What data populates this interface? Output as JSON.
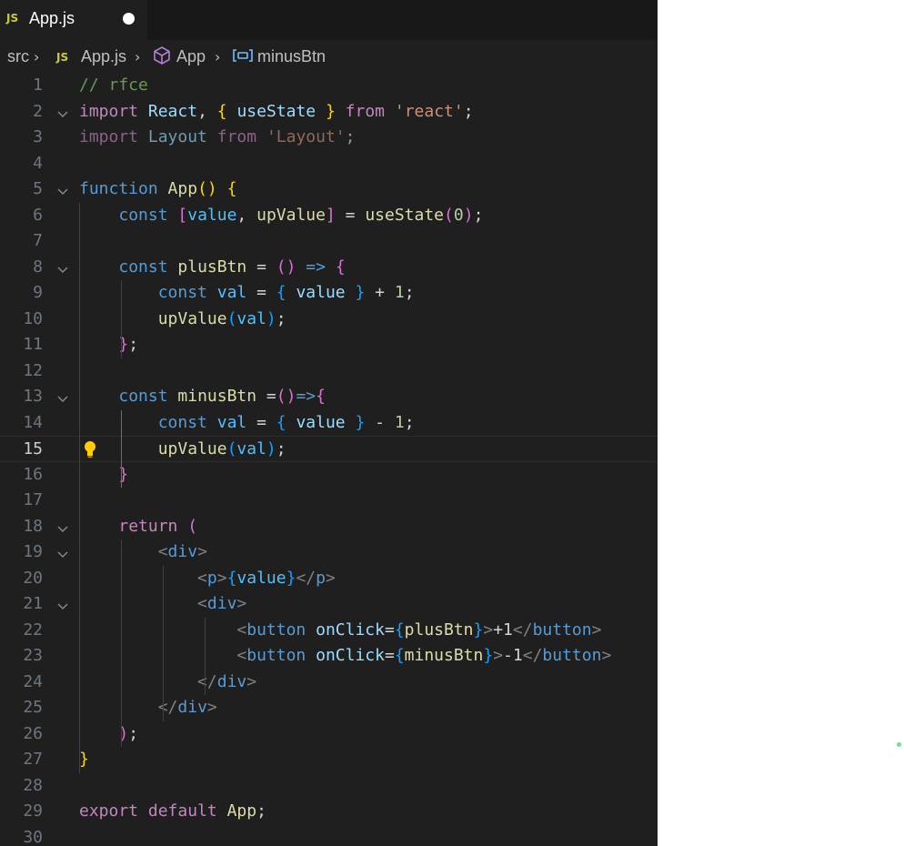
{
  "tab": {
    "badge": "JS",
    "label": "App.js"
  },
  "breadcrumb": {
    "src": "src",
    "js_badge": "JS",
    "file": "App.js",
    "symbol": "App",
    "member": "minusBtn"
  },
  "icons": {
    "folding": "chevron-down-icon",
    "symbol": "cube-icon",
    "variable": "variable-icon",
    "lightbulb": "lightbulb-icon"
  },
  "colors": {
    "editor_bg": "#1f1f1f",
    "tabbar_bg": "#181818",
    "js_badge": "#cbcb41",
    "bulb": "#ffcc00"
  },
  "active_line": 15,
  "lines": [
    {
      "n": "1",
      "fold": false,
      "tokens": [
        [
          "cm",
          "// rfce"
        ]
      ]
    },
    {
      "n": "2",
      "fold": true,
      "tokens": [
        [
          "kwc",
          "import"
        ],
        [
          "p",
          " "
        ],
        [
          "var",
          "React"
        ],
        [
          "p",
          ", "
        ],
        [
          "b1",
          "{"
        ],
        [
          "p",
          " "
        ],
        [
          "var",
          "useState"
        ],
        [
          "p",
          " "
        ],
        [
          "b1",
          "}"
        ],
        [
          "p",
          " "
        ],
        [
          "kwc",
          "from"
        ],
        [
          "p",
          " "
        ],
        [
          "str",
          "'react'"
        ],
        [
          "p",
          ";"
        ]
      ]
    },
    {
      "n": "3",
      "fold": false,
      "tokens": [
        [
          "kwc",
          "import"
        ],
        [
          "p",
          " "
        ],
        [
          "var",
          "Layout"
        ],
        [
          "p",
          " "
        ],
        [
          "kwc",
          "from"
        ],
        [
          "p",
          " "
        ],
        [
          "str",
          "'Layout'"
        ],
        [
          "p",
          ";"
        ]
      ],
      "dim": true
    },
    {
      "n": "4",
      "fold": false,
      "tokens": []
    },
    {
      "n": "5",
      "fold": true,
      "tokens": [
        [
          "kw",
          "function"
        ],
        [
          "p",
          " "
        ],
        [
          "fn",
          "App"
        ],
        [
          "b1",
          "()"
        ],
        [
          "p",
          " "
        ],
        [
          "b1",
          "{"
        ]
      ]
    },
    {
      "n": "6",
      "fold": false,
      "tokens": [
        [
          "p",
          "    "
        ],
        [
          "kw",
          "const"
        ],
        [
          "p",
          " "
        ],
        [
          "b2",
          "["
        ],
        [
          "cst",
          "value"
        ],
        [
          "p",
          ", "
        ],
        [
          "fn",
          "upValue"
        ],
        [
          "b2",
          "]"
        ],
        [
          "p",
          " = "
        ],
        [
          "fn",
          "useState"
        ],
        [
          "b2",
          "("
        ],
        [
          "num",
          "0"
        ],
        [
          "b2",
          ")"
        ],
        [
          "p",
          ";"
        ]
      ]
    },
    {
      "n": "7",
      "fold": false,
      "tokens": []
    },
    {
      "n": "8",
      "fold": true,
      "tokens": [
        [
          "p",
          "    "
        ],
        [
          "kw",
          "const"
        ],
        [
          "p",
          " "
        ],
        [
          "fn",
          "plusBtn"
        ],
        [
          "p",
          " = "
        ],
        [
          "b2",
          "()"
        ],
        [
          "p",
          " "
        ],
        [
          "kw",
          "=>"
        ],
        [
          "p",
          " "
        ],
        [
          "b2",
          "{"
        ]
      ]
    },
    {
      "n": "9",
      "fold": false,
      "tokens": [
        [
          "p",
          "        "
        ],
        [
          "kw",
          "const"
        ],
        [
          "p",
          " "
        ],
        [
          "cst",
          "val"
        ],
        [
          "p",
          " = "
        ],
        [
          "b3",
          "{"
        ],
        [
          "p",
          " "
        ],
        [
          "var",
          "value"
        ],
        [
          "p",
          " "
        ],
        [
          "b3",
          "}"
        ],
        [
          "p",
          " + "
        ],
        [
          "num",
          "1"
        ],
        [
          "p",
          ";"
        ]
      ]
    },
    {
      "n": "10",
      "fold": false,
      "tokens": [
        [
          "p",
          "        "
        ],
        [
          "fn",
          "upValue"
        ],
        [
          "b3",
          "("
        ],
        [
          "cst",
          "val"
        ],
        [
          "b3",
          ")"
        ],
        [
          "p",
          ";"
        ]
      ]
    },
    {
      "n": "11",
      "fold": false,
      "tokens": [
        [
          "p",
          "    "
        ],
        [
          "b2",
          "}"
        ],
        [
          "p",
          ";"
        ]
      ]
    },
    {
      "n": "12",
      "fold": false,
      "tokens": []
    },
    {
      "n": "13",
      "fold": true,
      "tokens": [
        [
          "p",
          "    "
        ],
        [
          "kw",
          "const"
        ],
        [
          "p",
          " "
        ],
        [
          "fn",
          "minusBtn"
        ],
        [
          "p",
          " ="
        ],
        [
          "b2",
          "()"
        ],
        [
          "kw",
          "=>"
        ],
        [
          "b2",
          "{"
        ]
      ]
    },
    {
      "n": "14",
      "fold": false,
      "tokens": [
        [
          "p",
          "        "
        ],
        [
          "kw",
          "const"
        ],
        [
          "p",
          " "
        ],
        [
          "cst",
          "val"
        ],
        [
          "p",
          " = "
        ],
        [
          "b3",
          "{"
        ],
        [
          "p",
          " "
        ],
        [
          "var",
          "value"
        ],
        [
          "p",
          " "
        ],
        [
          "b3",
          "}"
        ],
        [
          "p",
          " - "
        ],
        [
          "num",
          "1"
        ],
        [
          "p",
          ";"
        ]
      ]
    },
    {
      "n": "15",
      "fold": false,
      "bulb": true,
      "tokens": [
        [
          "p",
          "        "
        ],
        [
          "fn",
          "upValue"
        ],
        [
          "b3",
          "("
        ],
        [
          "cst",
          "val"
        ],
        [
          "b3",
          ")"
        ],
        [
          "p",
          ";"
        ]
      ]
    },
    {
      "n": "16",
      "fold": false,
      "tokens": [
        [
          "p",
          "    "
        ],
        [
          "b2",
          "}"
        ]
      ]
    },
    {
      "n": "17",
      "fold": false,
      "tokens": []
    },
    {
      "n": "18",
      "fold": true,
      "tokens": [
        [
          "p",
          "    "
        ],
        [
          "kwc",
          "return"
        ],
        [
          "p",
          " "
        ],
        [
          "b2",
          "("
        ]
      ]
    },
    {
      "n": "19",
      "fold": true,
      "tokens": [
        [
          "p",
          "        "
        ],
        [
          "ang",
          "<"
        ],
        [
          "tag",
          "div"
        ],
        [
          "ang",
          ">"
        ]
      ]
    },
    {
      "n": "20",
      "fold": false,
      "tokens": [
        [
          "p",
          "            "
        ],
        [
          "ang",
          "<"
        ],
        [
          "tag",
          "p"
        ],
        [
          "ang",
          ">"
        ],
        [
          "b3",
          "{"
        ],
        [
          "cst",
          "value"
        ],
        [
          "b3",
          "}"
        ],
        [
          "ang",
          "</"
        ],
        [
          "tag",
          "p"
        ],
        [
          "ang",
          ">"
        ]
      ]
    },
    {
      "n": "21",
      "fold": true,
      "tokens": [
        [
          "p",
          "            "
        ],
        [
          "ang",
          "<"
        ],
        [
          "tag",
          "div"
        ],
        [
          "ang",
          ">"
        ]
      ]
    },
    {
      "n": "22",
      "fold": false,
      "tokens": [
        [
          "p",
          "                "
        ],
        [
          "ang",
          "<"
        ],
        [
          "tag",
          "button"
        ],
        [
          "p",
          " "
        ],
        [
          "var",
          "onClick"
        ],
        [
          "p",
          "="
        ],
        [
          "b3",
          "{"
        ],
        [
          "fn",
          "plusBtn"
        ],
        [
          "b3",
          "}"
        ],
        [
          "ang",
          ">"
        ],
        [
          "txt",
          "+1"
        ],
        [
          "ang",
          "</"
        ],
        [
          "tag",
          "button"
        ],
        [
          "ang",
          ">"
        ]
      ]
    },
    {
      "n": "23",
      "fold": false,
      "tokens": [
        [
          "p",
          "                "
        ],
        [
          "ang",
          "<"
        ],
        [
          "tag",
          "button"
        ],
        [
          "p",
          " "
        ],
        [
          "var",
          "onClick"
        ],
        [
          "p",
          "="
        ],
        [
          "b3",
          "{"
        ],
        [
          "fn",
          "minusBtn"
        ],
        [
          "b3",
          "}"
        ],
        [
          "ang",
          ">"
        ],
        [
          "txt",
          "-1"
        ],
        [
          "ang",
          "</"
        ],
        [
          "tag",
          "button"
        ],
        [
          "ang",
          ">"
        ]
      ]
    },
    {
      "n": "24",
      "fold": false,
      "tokens": [
        [
          "p",
          "            "
        ],
        [
          "ang",
          "</"
        ],
        [
          "tag",
          "div"
        ],
        [
          "ang",
          ">"
        ]
      ]
    },
    {
      "n": "25",
      "fold": false,
      "tokens": [
        [
          "p",
          "        "
        ],
        [
          "ang",
          "</"
        ],
        [
          "tag",
          "div"
        ],
        [
          "ang",
          ">"
        ]
      ]
    },
    {
      "n": "26",
      "fold": false,
      "tokens": [
        [
          "p",
          "    "
        ],
        [
          "b2",
          ")"
        ],
        [
          "p",
          ";"
        ]
      ]
    },
    {
      "n": "27",
      "fold": false,
      "tokens": [
        [
          "b1",
          "}"
        ]
      ]
    },
    {
      "n": "28",
      "fold": false,
      "tokens": []
    },
    {
      "n": "29",
      "fold": false,
      "tokens": [
        [
          "kwc",
          "export"
        ],
        [
          "p",
          " "
        ],
        [
          "kwc",
          "default"
        ],
        [
          "p",
          " "
        ],
        [
          "fn",
          "App"
        ],
        [
          "p",
          ";"
        ]
      ]
    },
    {
      "n": "30",
      "fold": false,
      "tokens": []
    }
  ]
}
